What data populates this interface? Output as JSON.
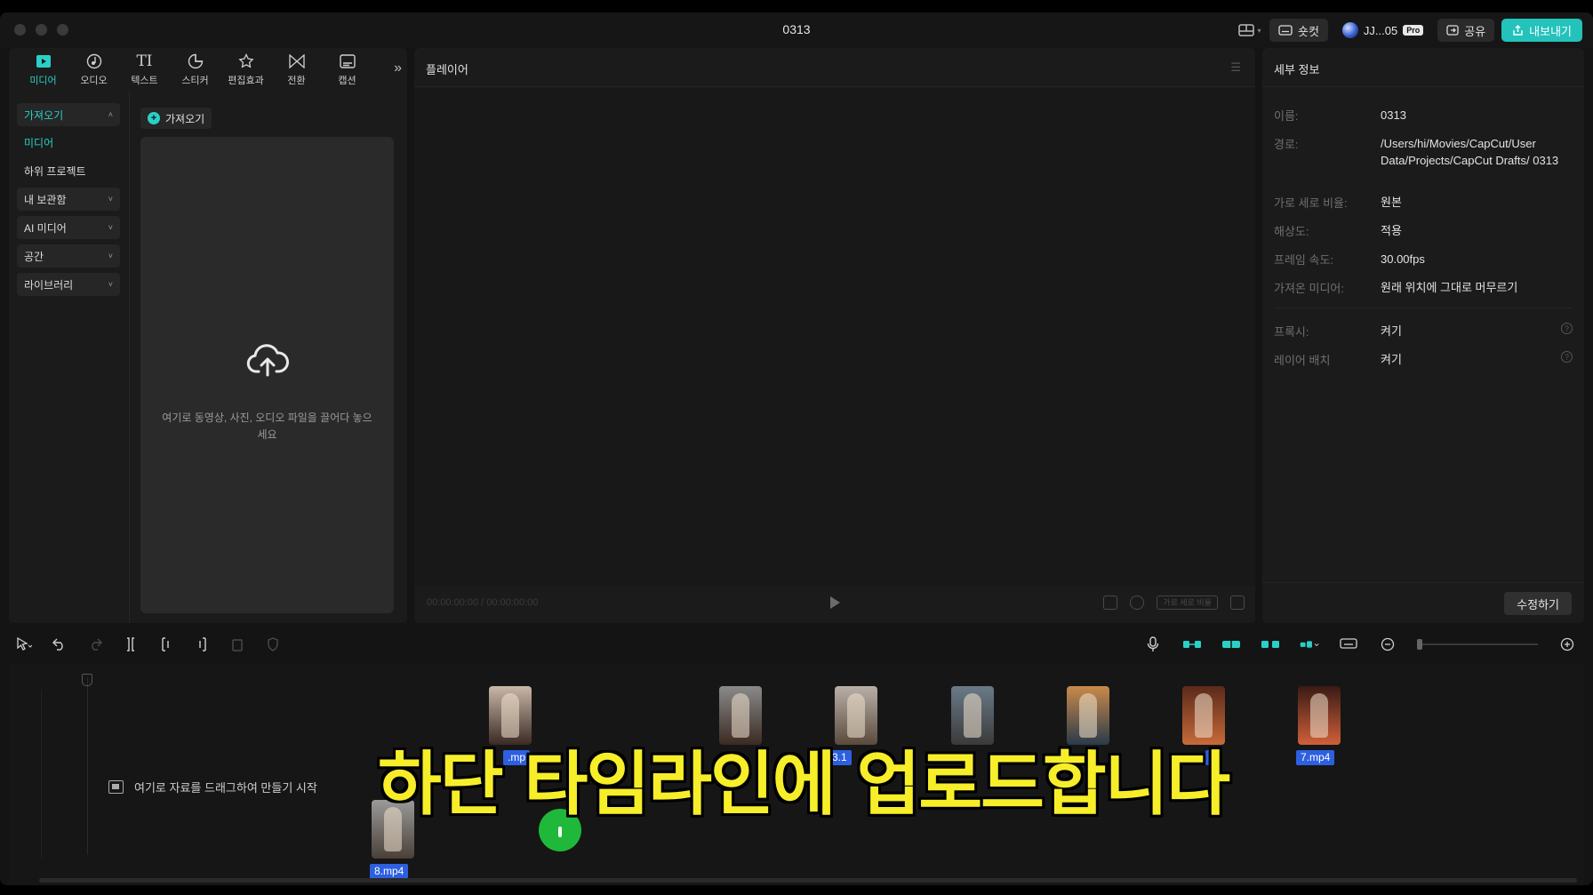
{
  "window": {
    "title": "0313"
  },
  "titlebar": {
    "shortcut_label": "숏컷",
    "user_name": "JJ...05",
    "pro_badge": "Pro",
    "share_label": "공유",
    "export_label": "내보내기"
  },
  "tool_tabs": [
    {
      "label": "미디어",
      "icon": "media-icon",
      "active": true
    },
    {
      "label": "오디오",
      "icon": "audio-icon",
      "active": false
    },
    {
      "label": "텍스트",
      "icon": "text-icon",
      "active": false
    },
    {
      "label": "스티커",
      "icon": "sticker-icon",
      "active": false
    },
    {
      "label": "편집효과",
      "icon": "effects-icon",
      "active": false
    },
    {
      "label": "전환",
      "icon": "transition-icon",
      "active": false
    },
    {
      "label": "캡션",
      "icon": "caption-icon",
      "active": false
    }
  ],
  "side_nav": {
    "import": "가져오기",
    "media": "미디어",
    "sub_project": "하위 프로젝트",
    "my_storage": "내 보관함",
    "ai_media": "AI 미디어",
    "space": "공간",
    "library": "라이브러리"
  },
  "media_panel": {
    "import_chip": "가져오기",
    "drop_text": "여기로 동영상, 사진, 오디오 파일을 끌어다 놓으세요"
  },
  "player": {
    "title": "플레이어",
    "timecode": "00:00:00:00 / 00:00:00:00",
    "ratio_label": "가로 세로 비율"
  },
  "details": {
    "title": "세부 정보",
    "props": [
      {
        "key": "이름:",
        "value": "0313"
      },
      {
        "key": "경로:",
        "value": "/Users/hi/Movies/CapCut/User Data/Projects/CapCut Drafts/ 0313"
      },
      {
        "key": "가로 세로 비율:",
        "value": "원본"
      },
      {
        "key": "해상도:",
        "value": "적용"
      },
      {
        "key": "프레임 속도:",
        "value": "30.00fps"
      },
      {
        "key": "가져온 미디어:",
        "value": "원래 위치에 그대로 머무르기"
      },
      {
        "key": "프록시:",
        "value": "켜기"
      },
      {
        "key": "레이어 배치",
        "value": "켜기"
      }
    ],
    "edit_button": "수정하기"
  },
  "timeline": {
    "drop_hint": "여기로 자료를 드래그하여 만들기 시작",
    "clips": [
      {
        "label": ".mp",
        "color_top": "#c9b7a8",
        "color_bottom": "#3a2a24"
      },
      {
        "label": "",
        "color_top": "#8a8a8a",
        "color_bottom": "#3b2a22"
      },
      {
        "label": "3.1",
        "color_top": "#b8b0a8",
        "color_bottom": "#5a4a3c"
      },
      {
        "label": "",
        "color_top": "#6a7a88",
        "color_bottom": "#3a3a3a"
      },
      {
        "label": "",
        "color_top": "#c98a4a",
        "color_bottom": "#2a3a4a"
      },
      {
        "label": "4",
        "color_top": "#5a2a1a",
        "color_bottom": "#c86a3a"
      },
      {
        "label": "7.mp4",
        "color_top": "#3a1a14",
        "color_bottom": "#d0603a"
      },
      {
        "label": "8.mp4",
        "color_top": "#9a9a9a",
        "color_bottom": "#4a4038"
      }
    ]
  },
  "overlay_caption": "하단 타임라인에 업로드합니다",
  "colors": {
    "accent": "#2ad0c7",
    "clip_label": "#2d5fe0",
    "caption": "#f7ee2a"
  }
}
